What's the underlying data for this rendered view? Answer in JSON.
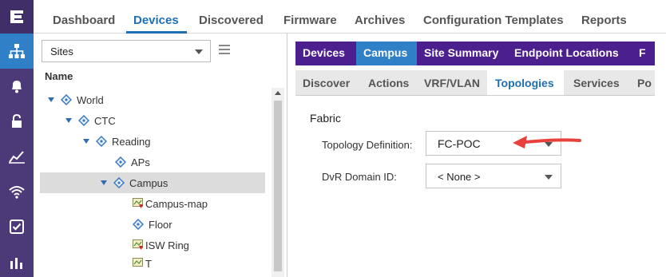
{
  "nav": {
    "items": [
      "Dashboard",
      "Devices",
      "Discovered",
      "Firmware",
      "Archives",
      "Configuration Templates",
      "Reports"
    ],
    "active": "Devices"
  },
  "sites_panel": {
    "selector_value": "Sites",
    "tree_header": "Name",
    "tree": [
      {
        "label": "World",
        "type": "site",
        "expanded": true
      },
      {
        "label": "CTC",
        "type": "site",
        "expanded": true
      },
      {
        "label": "Reading",
        "type": "site",
        "expanded": true
      },
      {
        "label": "APs",
        "type": "site",
        "expanded": false
      },
      {
        "label": "Campus",
        "type": "site",
        "expanded": true,
        "selected": true
      },
      {
        "label": "Campus-map",
        "type": "map"
      },
      {
        "label": "Floor",
        "type": "site"
      },
      {
        "label": "ISW Ring",
        "type": "map"
      },
      {
        "label": "T",
        "type": "map"
      }
    ]
  },
  "primary_tabs": [
    "Devices",
    "Campus",
    "Site Summary",
    "Endpoint Locations",
    "F"
  ],
  "secondary_tabs": [
    "Discover",
    "Actions",
    "VRF/VLAN",
    "Topologies",
    "Services",
    "Po"
  ],
  "fabric": {
    "section_title": "Fabric",
    "topology_label": "Topology Definition:",
    "topology_value": "FC-POC",
    "dvr_label": "DvR Domain ID:",
    "dvr_value": "< None >"
  },
  "colors": {
    "rail": "#4c3a78",
    "primary_tabs": "#4c1f8e",
    "accent": "#2f80c7",
    "annotation_arrow": "#e8413c"
  }
}
